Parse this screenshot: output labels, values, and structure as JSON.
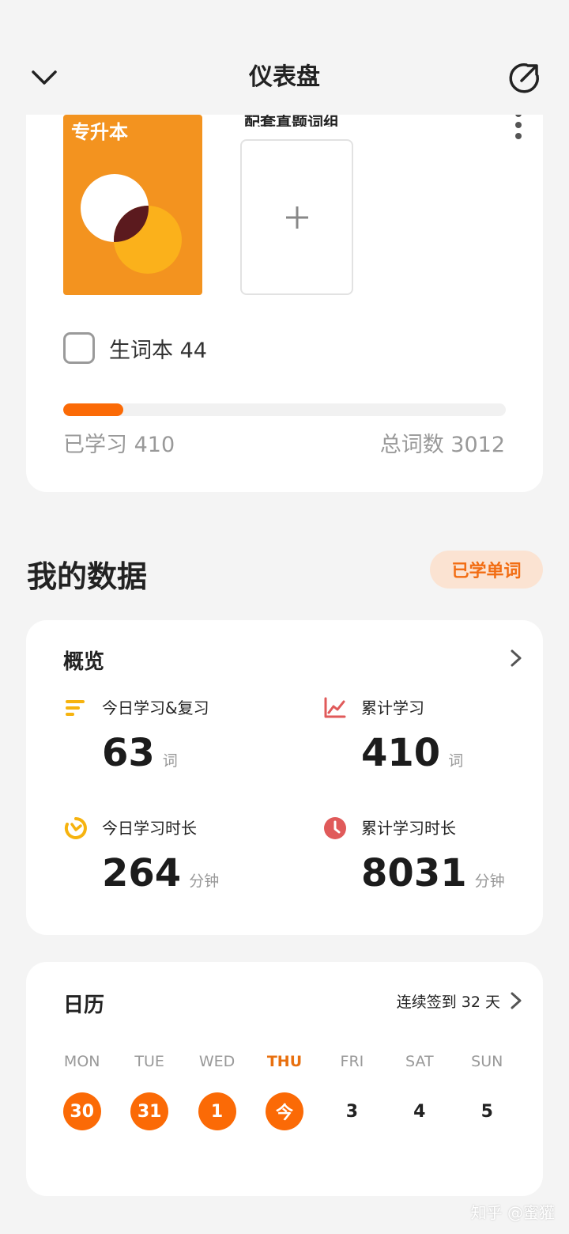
{
  "header": {
    "title": "仪表盘"
  },
  "book": {
    "cover_title": "专升本",
    "exam_group_label": "配套真题词组",
    "vocab_label": "生词本 44",
    "learned_text": "已学习 410",
    "total_text": "总词数 3012",
    "progress_fraction": 0.136
  },
  "section": {
    "title": "我的数据",
    "pill_label": "已学单词"
  },
  "overview": {
    "title": "概览",
    "stats": [
      {
        "label": "今日学习&复习",
        "value": "63",
        "unit": "词",
        "icon": "bars-icon",
        "color": "#f6b30f"
      },
      {
        "label": "累计学习",
        "value": "410",
        "unit": "词",
        "icon": "line-chart-icon",
        "color": "#e05a5a"
      },
      {
        "label": "今日学习时长",
        "value": "264",
        "unit": "分钟",
        "icon": "timer-icon",
        "color": "#f6b30f"
      },
      {
        "label": "累计学习时长",
        "value": "8031",
        "unit": "分钟",
        "icon": "clock-icon",
        "color": "#e05a5a"
      }
    ]
  },
  "calendar": {
    "title": "日历",
    "streak": "连续签到 32 天",
    "days": [
      {
        "name": "MON",
        "num": "30",
        "checked": true
      },
      {
        "name": "TUE",
        "num": "31",
        "checked": true
      },
      {
        "name": "WED",
        "num": "1",
        "checked": true
      },
      {
        "name": "THU",
        "num": "今",
        "checked": true,
        "today": true
      },
      {
        "name": "FRI",
        "num": "3",
        "checked": false
      },
      {
        "name": "SAT",
        "num": "4",
        "checked": false
      },
      {
        "name": "SUN",
        "num": "5",
        "checked": false
      }
    ]
  },
  "colors": {
    "accent": "#fb6a06",
    "pill_bg": "#fbe3d2",
    "pill_text": "#f26d13"
  },
  "watermark": "知乎 @蜜獾"
}
